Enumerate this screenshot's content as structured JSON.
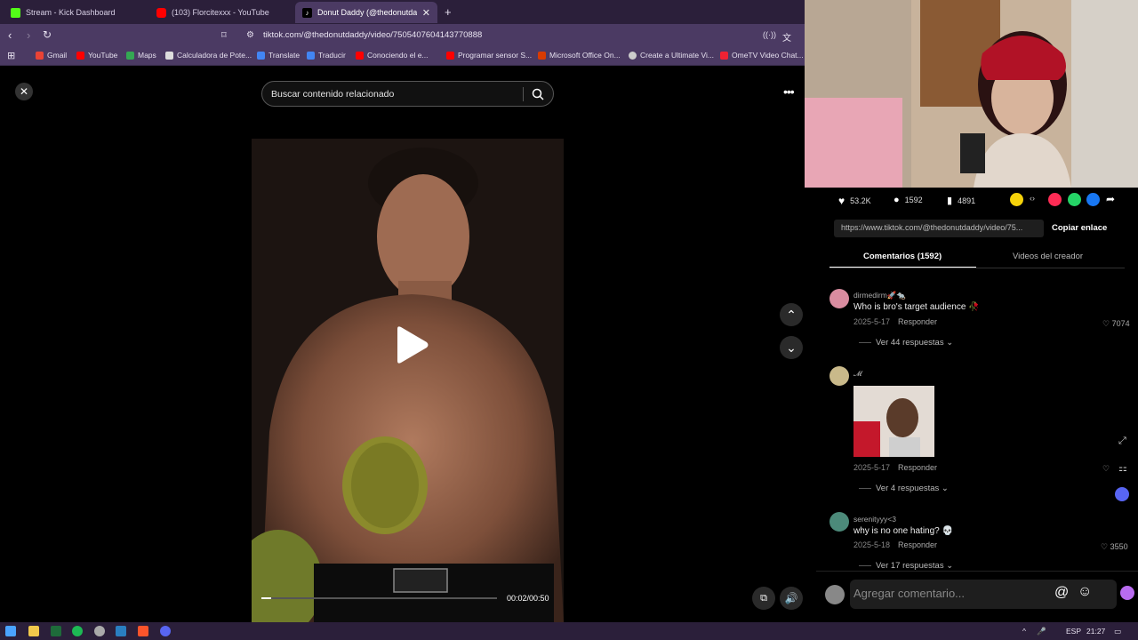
{
  "browser": {
    "tabs": [
      {
        "title": "Stream - Kick Dashboard",
        "icon": "kick-icon",
        "color": "#53fc18"
      },
      {
        "title": "(103) Florcitexxx - YouTube",
        "icon": "youtube-icon",
        "color": "#ff0000"
      },
      {
        "title": "Donut Daddy (@thedonutdaddy",
        "icon": "tiktok-icon",
        "color": "#ffffff"
      }
    ],
    "url": "tiktok.com/@thedonutdaddy/video/7505407604143770888",
    "bookmarks": [
      "Gmail",
      "YouTube",
      "Maps",
      "Calculadora de Pote...",
      "Translate",
      "Traducir",
      "Conociendo el e...",
      "Programar sensor S...",
      "Microsoft Office On...",
      "Create a Ultimate Vi...",
      "OmeTV Video Chat..."
    ]
  },
  "search": {
    "placeholder": "Buscar contenido relacionado"
  },
  "video": {
    "time": "00:02/00:50",
    "progress": 0.04
  },
  "stats": {
    "likes": "53.2K",
    "comments": "1592",
    "saves": "4891"
  },
  "link": {
    "url": "https://www.tiktok.com/@thedonutdaddy/video/75...",
    "copy_label": "Copiar enlace"
  },
  "panel_tabs": {
    "comments": "Comentarios (1592)",
    "creator_videos": "Videos del creador"
  },
  "comments": [
    {
      "user": "dirmedirm🚀🐀",
      "text": "Who is bro's target audience 🥀",
      "date": "2025-5-17",
      "reply": "Responder",
      "likes": "7074",
      "replies": "Ver 44 respuestas"
    },
    {
      "user": "𝓜",
      "text": "",
      "date": "2025-5-17",
      "reply": "Responder",
      "likes": "",
      "replies": "Ver 4 respuestas"
    },
    {
      "user": "serenityyy<3",
      "text": "why is no one hating? 💀",
      "date": "2025-5-18",
      "reply": "Responder",
      "likes": "3550",
      "replies": "Ver 17 respuestas"
    }
  ],
  "comment_input": {
    "placeholder": "Agregar comentario..."
  },
  "taskbar": {
    "lang": "ESP",
    "time": "21:27"
  },
  "colors": {
    "accent": "#fe2c55",
    "chrome": "#4b3a63",
    "taskbar": "#2b1f3a"
  }
}
